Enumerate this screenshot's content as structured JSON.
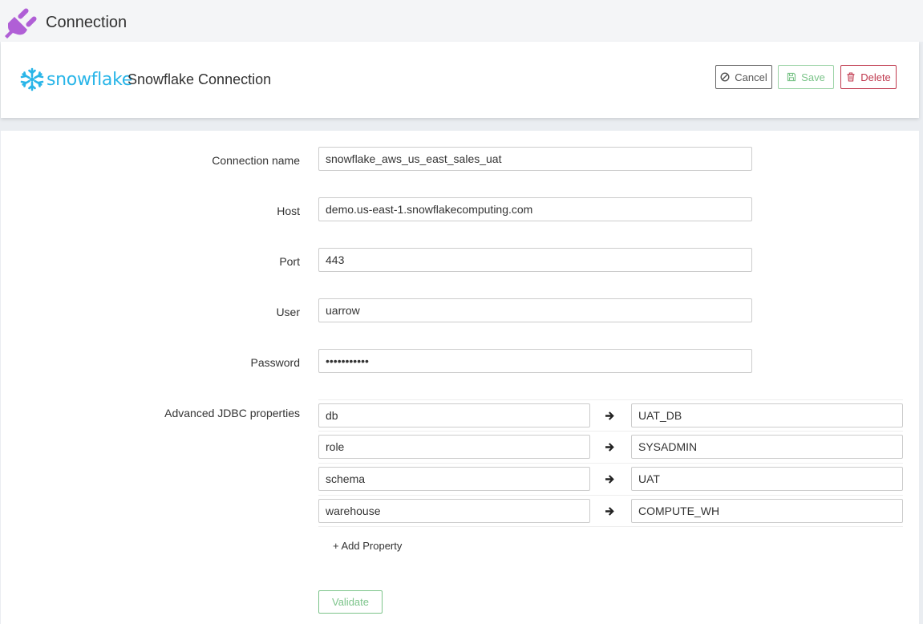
{
  "header": {
    "title": "Connection",
    "icon": "plug-icon",
    "icon_color": "#b05fd6"
  },
  "connection_card": {
    "brand_wordmark": "snowflake",
    "title": "Snowflake Connection",
    "brand_color": "#29b5e8",
    "buttons": {
      "cancel": "Cancel",
      "save": "Save",
      "delete": "Delete"
    }
  },
  "form": {
    "fields": {
      "connection_name": {
        "label": "Connection name",
        "value": "snowflake_aws_us_east_sales_uat"
      },
      "host": {
        "label": "Host",
        "value": "demo.us-east-1.snowflakecomputing.com"
      },
      "port": {
        "label": "Port",
        "value": "443"
      },
      "user": {
        "label": "User",
        "value": "uarrow"
      },
      "password": {
        "label": "Password",
        "value": "•••••••••••"
      }
    },
    "advanced": {
      "label": "Advanced JDBC properties",
      "properties": [
        {
          "key": "db",
          "value": "UAT_DB"
        },
        {
          "key": "role",
          "value": "SYSADMIN"
        },
        {
          "key": "schema",
          "value": "UAT"
        },
        {
          "key": "warehouse",
          "value": "COMPUTE_WH"
        }
      ],
      "add_label": "+ Add Property"
    },
    "validate_label": "Validate"
  }
}
